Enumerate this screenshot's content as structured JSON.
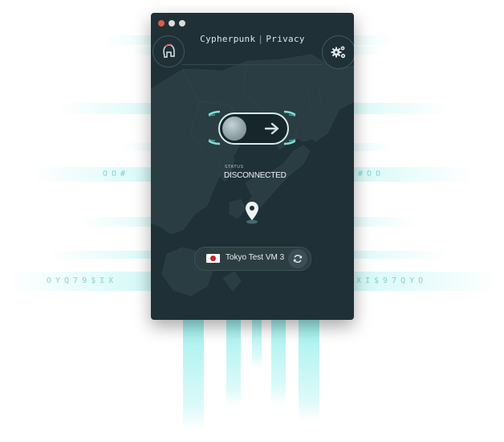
{
  "window": {
    "title_brand": "Cypherpunk",
    "title_separator": "|",
    "title_product": "Privacy"
  },
  "status": {
    "label": "STATUS",
    "value": "DISCONNECTED"
  },
  "server": {
    "name": "Tokyo Test VM 3",
    "country_flag": "japan-flag"
  },
  "background_glyphs": {
    "left_upper": "OO#",
    "right_upper": "#OO",
    "left_lower": "OYQ79$IX",
    "right_lower": "XI$97QYO"
  },
  "colors": {
    "window_bg": "#1f3036",
    "accent_cyan": "#78ebe6",
    "close_button": "#e05a4f",
    "flag_red": "#c8202f"
  },
  "icons": {
    "logo": "spartan-helmet-icon",
    "settings": "gears-icon",
    "toggle_arrow": "arrow-right-icon",
    "location": "map-pin-icon",
    "refresh": "refresh-icon"
  }
}
